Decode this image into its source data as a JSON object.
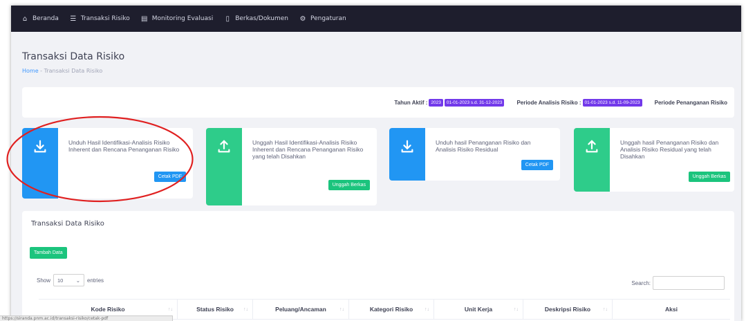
{
  "nav": {
    "items": [
      {
        "label": "Beranda",
        "icon": "home-icon"
      },
      {
        "label": "Transaksi Risiko",
        "icon": "list-icon"
      },
      {
        "label": "Monitoring Evaluasi",
        "icon": "chart-icon"
      },
      {
        "label": "Berkas/Dokumen",
        "icon": "document-icon"
      },
      {
        "label": "Pengaturan",
        "icon": "gear-icon"
      }
    ]
  },
  "page": {
    "title": "Transaksi Data Risiko",
    "breadcrumb_home": "Home",
    "breadcrumb_sep": "-",
    "breadcrumb_current": "Transaksi Data Risiko"
  },
  "period": {
    "tahun_label": "Tahun Aktif :",
    "tahun_value": "2023",
    "tahun_range": "01-01-2023 s.d. 31-12-2023",
    "analisis_label": "Periode Analisis Risiko :",
    "analisis_range": "01-01-2023 s.d. 11-09-2023",
    "penanganan_label": "Periode Penanganan Risiko"
  },
  "cards": [
    {
      "text": "Unduh Hasil Identifikasi-Analisis Risiko Inherent dan Rencana Penanganan Risiko",
      "button": "Cetak PDF",
      "icon": "download-icon",
      "accent": "#2196f3"
    },
    {
      "text": "Unggah Hasil Identifikasi-Analisis Risiko Inherent dan Rencana Penanganan Risiko yang telah Disahkan",
      "button": "Unggah Berkas",
      "icon": "upload-icon",
      "accent": "#2ecc8a"
    },
    {
      "text": "Unduh hasil Penanganan Risiko dan Analisis Risiko Residual",
      "button": "Cetak PDF",
      "icon": "download-icon",
      "accent": "#2196f3"
    },
    {
      "text": "Unggah hasil Penanganan Risiko dan Analisis Risiko Residual yang telah Disahkan",
      "button": "Unggah Berkas",
      "icon": "upload-icon",
      "accent": "#2ecc8a"
    }
  ],
  "table": {
    "title": "Transaksi Data Risiko",
    "add_button": "Tambah Data",
    "show_label": "Show",
    "show_value": "10",
    "entries_label": "entries",
    "search_label": "Search:",
    "columns": [
      "Kode Risiko",
      "Status Risiko",
      "Peluang/Ancaman",
      "Kategori Risiko",
      "Unit Kerja",
      "Deskripsi Risiko",
      "Aksi"
    ]
  },
  "statusbar": {
    "text": "https://siranda.pnm.ac.id/transaksi-risiko/cetak-pdf"
  },
  "colors": {
    "nav_bg": "#1e1e2d",
    "blue": "#2196f3",
    "green": "#1bc47d",
    "badge": "#7239ea",
    "annotation": "#e02020"
  }
}
